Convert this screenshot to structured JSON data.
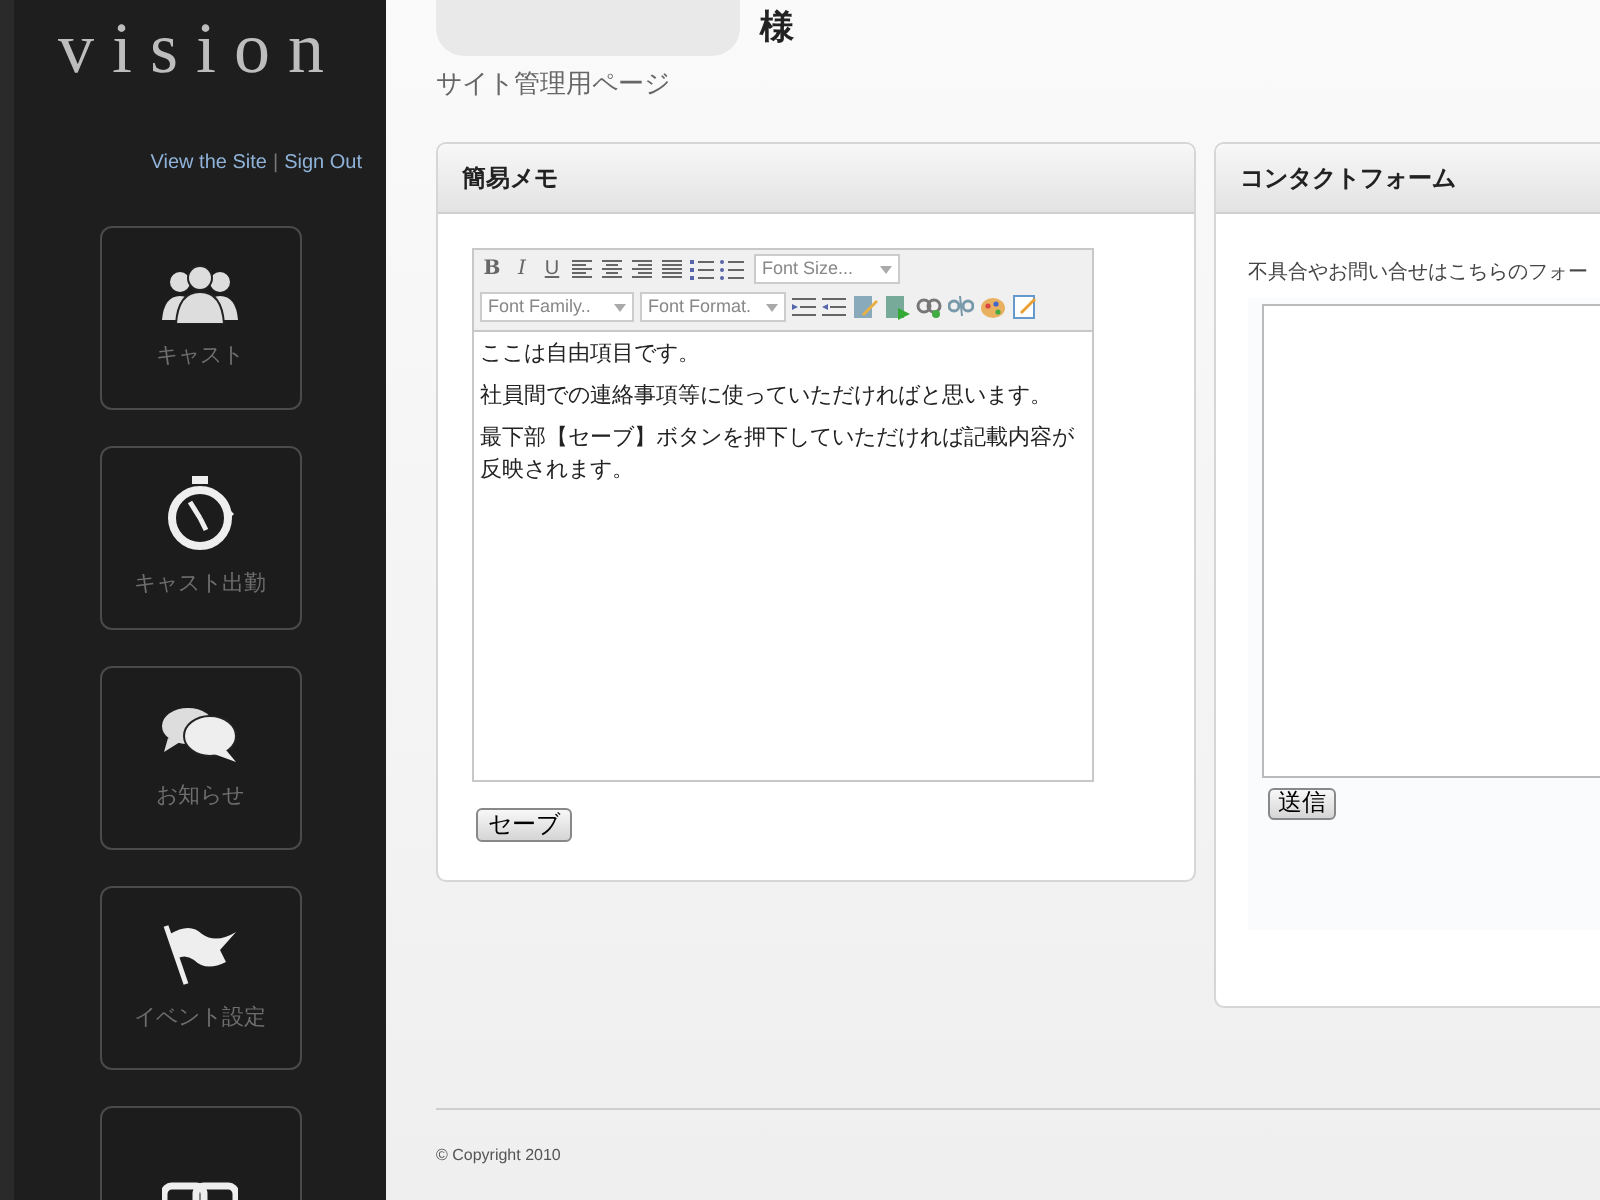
{
  "sidebar": {
    "logo": "vision",
    "links": [
      "View the Site",
      "Sign Out"
    ],
    "link_separator": "|",
    "items": [
      {
        "label": "キャスト"
      },
      {
        "label": "キャスト出勤"
      },
      {
        "label": "お知らせ"
      },
      {
        "label": "イベント設定"
      }
    ]
  },
  "header": {
    "honorific": "様",
    "subtitle": "サイト管理用ページ"
  },
  "memo_panel": {
    "title": "簡易メモ",
    "format_buttons": [
      "B",
      "I",
      "U"
    ],
    "font_size": "Font Size...",
    "font_family": "Font Family..",
    "font_format": "Font Format.",
    "paragraphs": [
      "ここは自由項目です。",
      "社員間での連絡事項等に使っていただければと思います。",
      "最下部【セーブ】ボタンを押下していただければ記載内容が反映されます。"
    ],
    "save_button": "セーブ"
  },
  "contact_panel": {
    "title": "コンタクトフォーム",
    "intro": "不具合やお問い合せはこちらのフォー",
    "send_button": "送信"
  },
  "footer": {
    "copyright": "© Copyright 2010"
  }
}
